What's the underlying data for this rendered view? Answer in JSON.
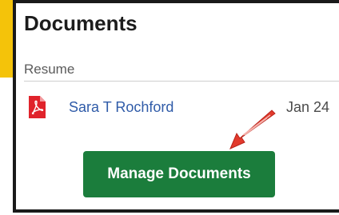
{
  "panel": {
    "title": "Documents",
    "section_label": "Resume"
  },
  "documents": [
    {
      "icon": "pdf-file-icon",
      "name": "Sara T Rochford",
      "date": "Jan 24"
    }
  ],
  "actions": {
    "manage_label": "Manage Documents"
  },
  "annotation": {
    "icon": "red-arrow-icon"
  },
  "colors": {
    "accent_yellow": "#f4c30a",
    "button_green": "#1b7d3c",
    "link_blue": "#2f5ba8",
    "pdf_red": "#e0232b",
    "arrow_red": "#e23a2c"
  }
}
